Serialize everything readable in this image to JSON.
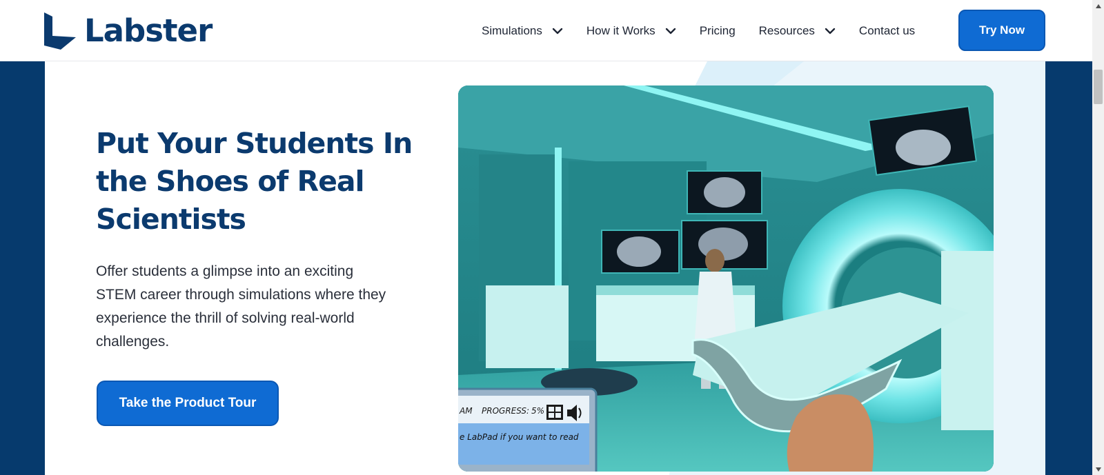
{
  "header": {
    "logo_text": "Labster",
    "nav": [
      {
        "label": "Simulations",
        "has_dropdown": true
      },
      {
        "label": "How it Works",
        "has_dropdown": true
      },
      {
        "label": "Pricing",
        "has_dropdown": false
      },
      {
        "label": "Resources",
        "has_dropdown": true
      },
      {
        "label": "Contact us",
        "has_dropdown": false
      }
    ],
    "cta": "Try Now"
  },
  "hero": {
    "title": "Put Your Students In the Shoes of Real Scientists",
    "description": "Offer students a glimpse into an exciting STEM career through simulations where they experience the thrill of solving real-world challenges.",
    "button": "Take the Product Tour"
  },
  "scene": {
    "hud_left": "AM",
    "hud_progress_label": "PROGRESS:",
    "hud_progress_value": "5%",
    "hud_message": "e LabPad if you want to read"
  },
  "colors": {
    "brand_navy": "#0b3a6e",
    "band": "#063a6d",
    "button_blue": "#0f6bd3"
  }
}
